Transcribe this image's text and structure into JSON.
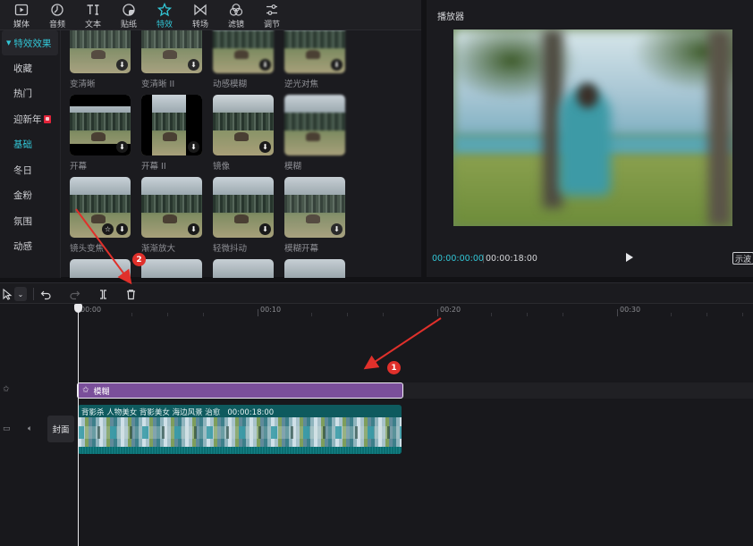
{
  "toolbar": {
    "tabs": [
      {
        "label": "媒体",
        "icon": "media-icon"
      },
      {
        "label": "音频",
        "icon": "audio-icon"
      },
      {
        "label": "文本",
        "icon": "text-icon"
      },
      {
        "label": "贴纸",
        "icon": "sticker-icon"
      },
      {
        "label": "特效",
        "icon": "effects-icon",
        "active": true
      },
      {
        "label": "转场",
        "icon": "transition-icon"
      },
      {
        "label": "滤镜",
        "icon": "filter-icon"
      },
      {
        "label": "调节",
        "icon": "adjust-icon"
      }
    ],
    "accent": "#32c6d6"
  },
  "sidebar": {
    "header": "特效效果",
    "items": [
      "收藏",
      "热门",
      "迎新年",
      "基础",
      "冬日",
      "金粉",
      "氛围",
      "动感"
    ],
    "active": "基础"
  },
  "effects": {
    "row1": [
      "变清晰",
      "变清晰 II",
      "动感模糊",
      "逆光对焦"
    ],
    "row2": [
      "开幕",
      "开幕 II",
      "镜像",
      "模糊"
    ],
    "row3": [
      "镜头变焦",
      "渐渐放大",
      "轻微抖动",
      "模糊开幕"
    ]
  },
  "player": {
    "title": "播放器",
    "current_time": "00:00:00:00",
    "total_time": "00:00:18:00",
    "ratio_label": "示波"
  },
  "timeline": {
    "ruler": [
      "00:00",
      "00:10",
      "00:20",
      "00:30"
    ],
    "effect_clip": {
      "label": "模糊",
      "color": "#7a4f9a"
    },
    "video_clip": {
      "name": "背影杀 人物美女 背影美女 海边风景 治愈",
      "duration": "00:00:18:00",
      "color": "#0e5a5e"
    },
    "cover_label": "封面"
  },
  "annotations": {
    "marker1": "1",
    "marker2": "2",
    "color": "#e0302b"
  }
}
